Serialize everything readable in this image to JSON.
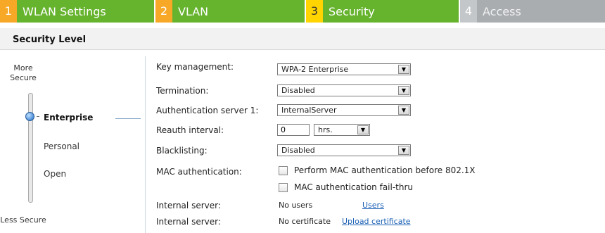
{
  "wizard": {
    "steps": [
      {
        "num": "1",
        "label": "WLAN Settings"
      },
      {
        "num": "2",
        "label": "VLAN"
      },
      {
        "num": "3",
        "label": "Security"
      },
      {
        "num": "4",
        "label": "Access"
      }
    ],
    "active_step": "3"
  },
  "section": {
    "title": "Security Level"
  },
  "security_level": {
    "top_label": "More Secure",
    "bottom_label": "Less Secure",
    "options": [
      "Enterprise",
      "Personal",
      "Open"
    ],
    "selected": "Enterprise"
  },
  "form": {
    "key_management": {
      "label": "Key management:",
      "value": "WPA-2 Enterprise"
    },
    "termination": {
      "label": "Termination:",
      "value": "Disabled"
    },
    "auth_server1": {
      "label": "Authentication server 1:",
      "value": "InternalServer"
    },
    "reauth_interval": {
      "label": "Reauth interval:",
      "value": "0",
      "unit": "hrs."
    },
    "blacklisting": {
      "label": "Blacklisting:",
      "value": "Disabled"
    },
    "mac_auth": {
      "label": "MAC authentication:",
      "option1": "Perform MAC authentication before 802.1X",
      "option2": "MAC authentication fail-thru",
      "option1_checked": false,
      "option2_checked": false
    },
    "internal_server_users": {
      "label": "Internal server:",
      "value": "No users",
      "link": "Users"
    },
    "internal_server_cert": {
      "label": "Internal server:",
      "value": "No certificate",
      "link": "Upload certificate"
    }
  },
  "colors": {
    "step_green": "#66b32e",
    "step_orange": "#f7a826",
    "step_yellow": "#ffd400",
    "step_gray": "#a9adb0",
    "link": "#1a5fb4"
  }
}
